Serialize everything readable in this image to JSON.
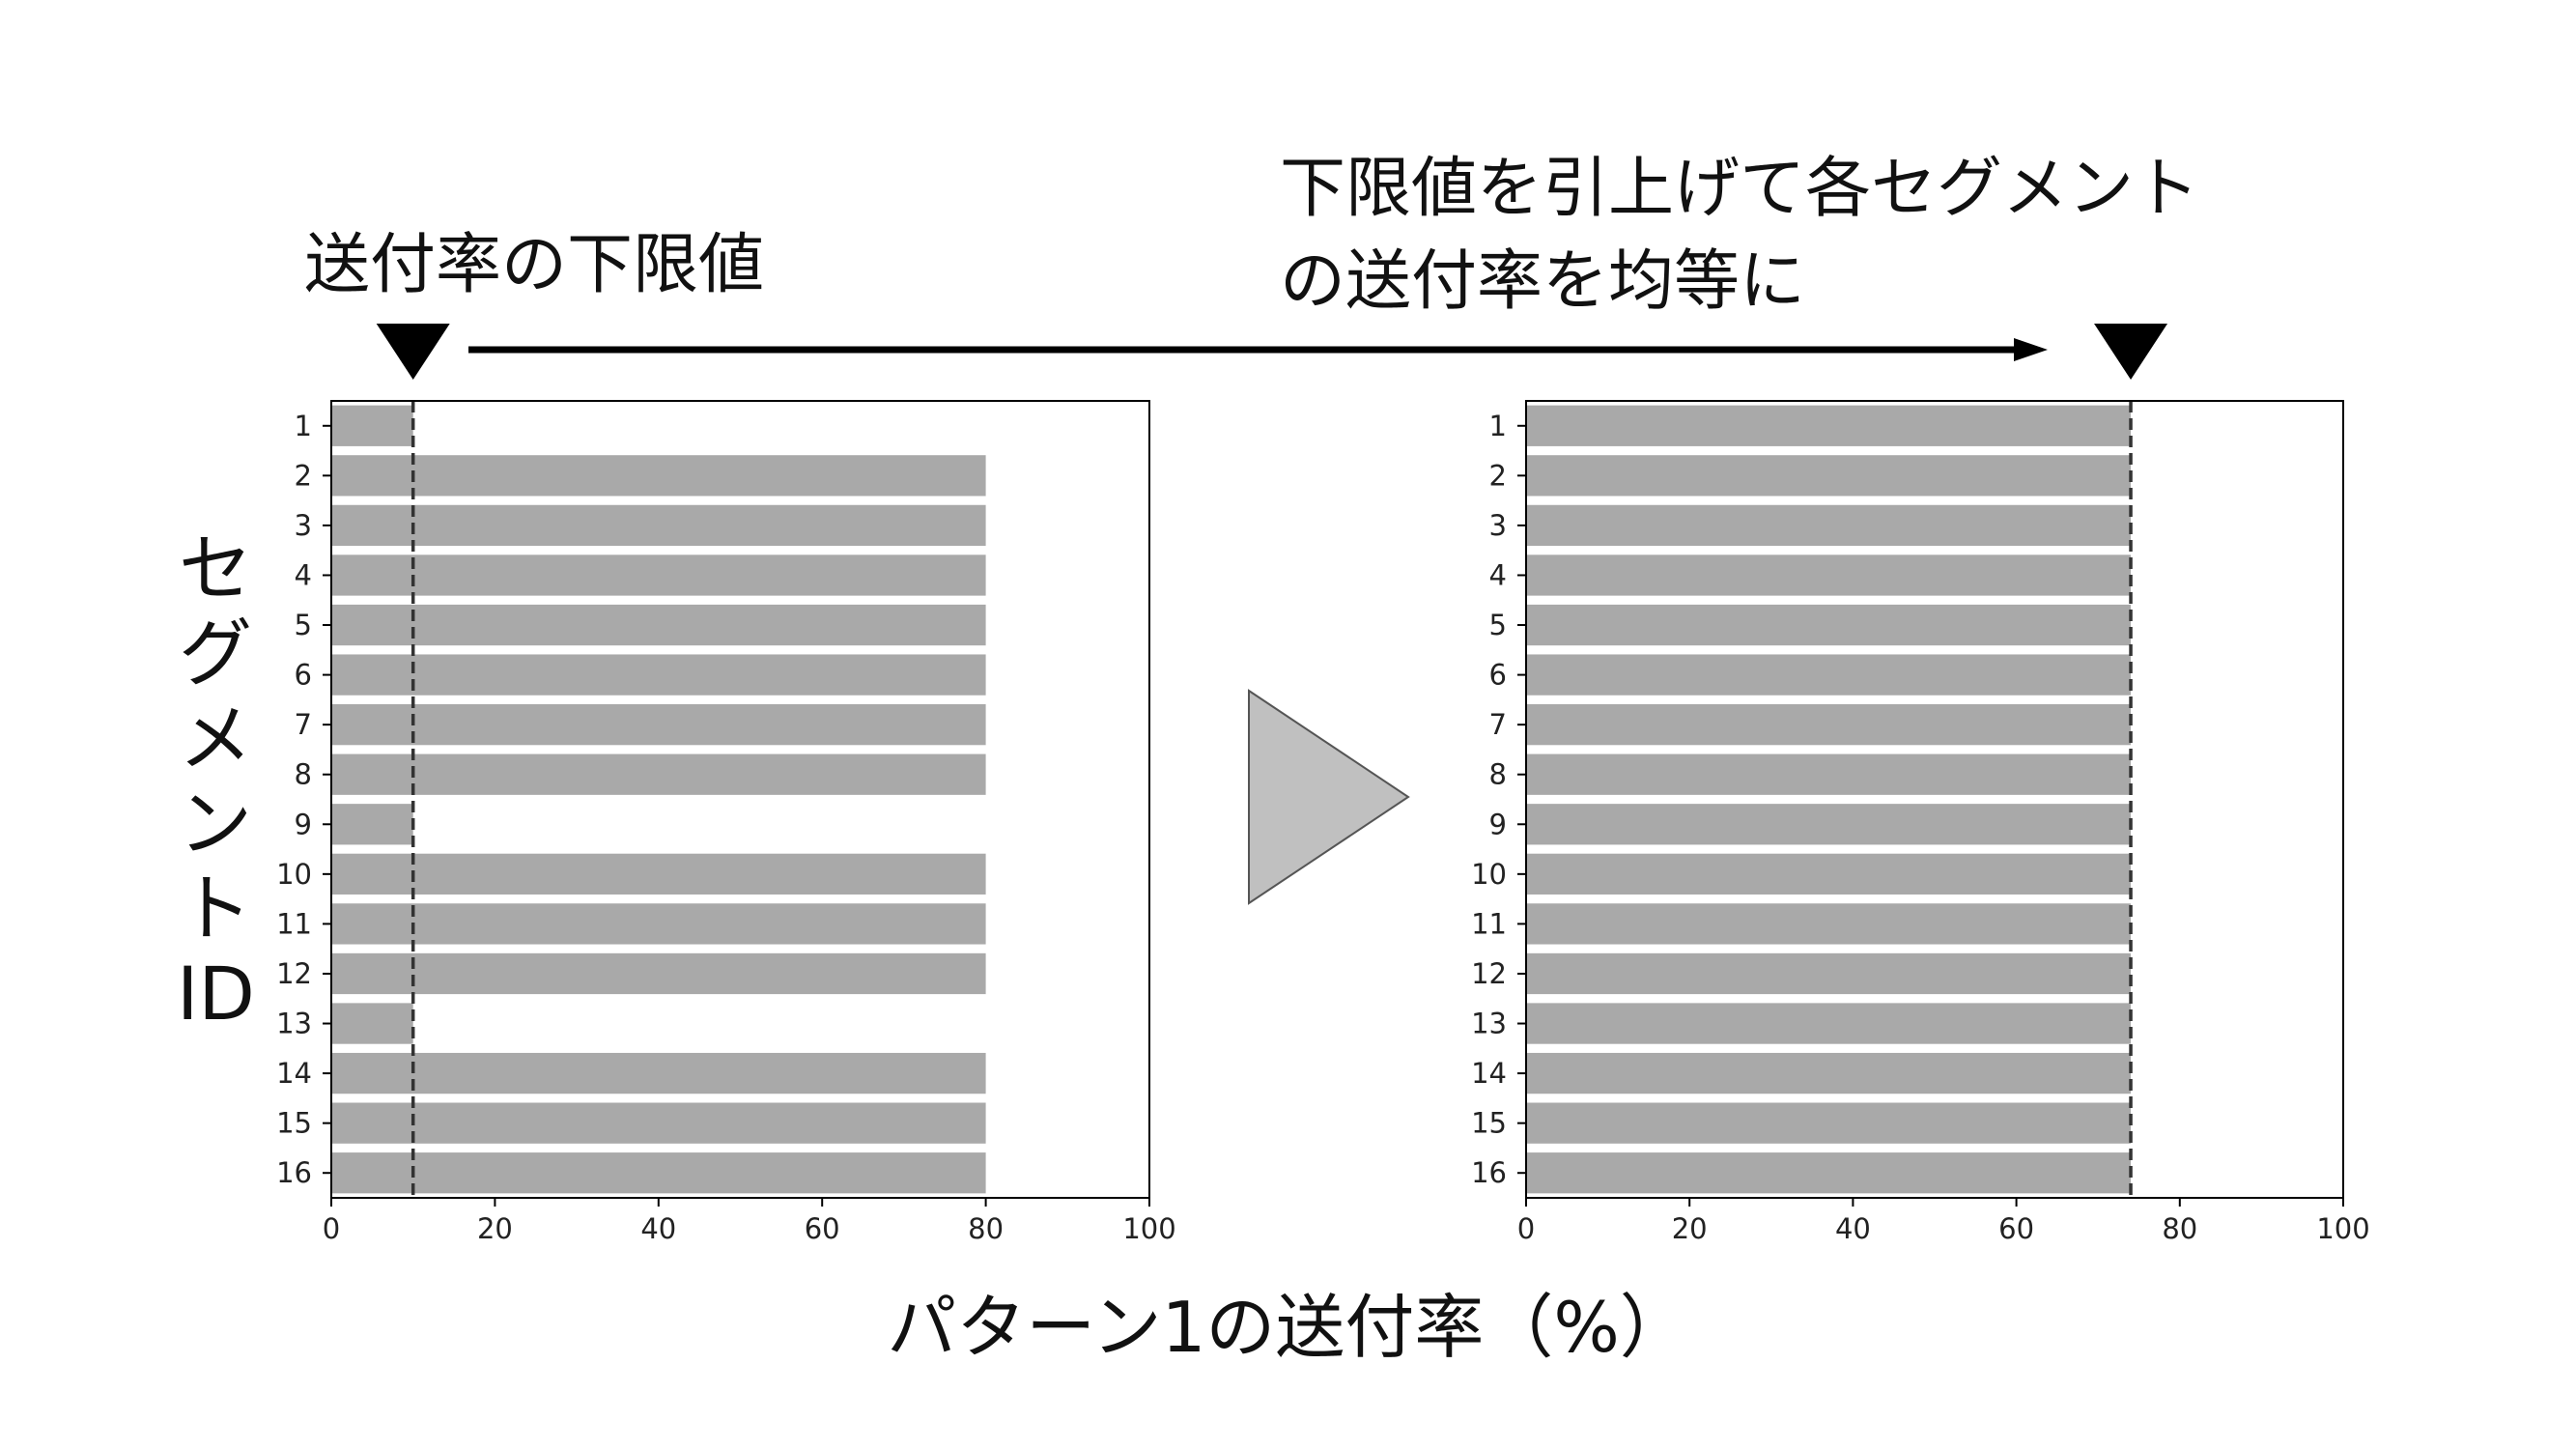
{
  "annotations": {
    "left": "送付率の下限値",
    "right_line1": "下限値を引上げて各セグメント",
    "right_line2": "の送付率を均等に"
  },
  "y_label_chars": [
    "セ",
    "グ",
    "メ",
    "ン",
    "ト",
    "ID"
  ],
  "x_label": "パターン1の送付率（%）",
  "colors": {
    "bar": "#a9a9a9",
    "threshold": "#333333",
    "arrow": "#000000",
    "transition_triangle": "#c0c0c0"
  },
  "chart_data": [
    {
      "type": "bar",
      "orientation": "horizontal",
      "categories": [
        "1",
        "2",
        "3",
        "4",
        "5",
        "6",
        "7",
        "8",
        "9",
        "10",
        "11",
        "12",
        "13",
        "14",
        "15",
        "16"
      ],
      "values": [
        10,
        80,
        80,
        80,
        80,
        80,
        80,
        80,
        10,
        80,
        80,
        80,
        10,
        80,
        80,
        80
      ],
      "threshold": 10,
      "xlim": [
        0,
        100
      ],
      "xticks": [
        0,
        20,
        40,
        60,
        80,
        100
      ],
      "grid": false
    },
    {
      "type": "bar",
      "orientation": "horizontal",
      "categories": [
        "1",
        "2",
        "3",
        "4",
        "5",
        "6",
        "7",
        "8",
        "9",
        "10",
        "11",
        "12",
        "13",
        "14",
        "15",
        "16"
      ],
      "values": [
        74,
        74,
        74,
        74,
        74,
        74,
        74,
        74,
        74,
        74,
        74,
        74,
        74,
        74,
        74,
        74
      ],
      "threshold": 74,
      "xlim": [
        0,
        100
      ],
      "xticks": [
        0,
        20,
        40,
        60,
        80,
        100
      ],
      "grid": false
    }
  ]
}
